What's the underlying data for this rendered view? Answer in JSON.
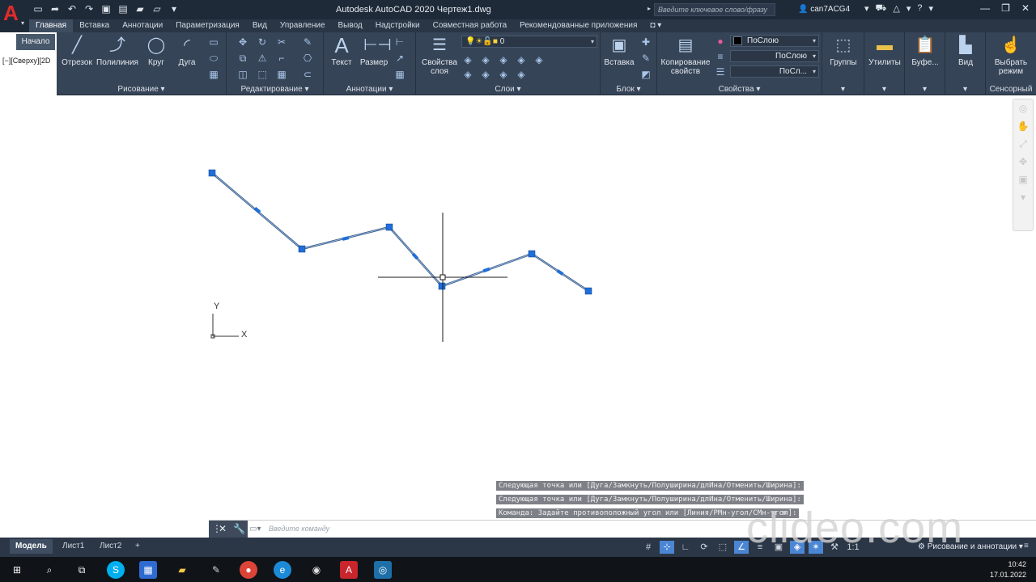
{
  "window": {
    "title": "Autodesk AutoCAD 2020   Чертеж1.dwg",
    "search_placeholder": "Введите ключевое слово/фразу",
    "user": "can7ACG4"
  },
  "ribbon_tabs": [
    "Главная",
    "Вставка",
    "Аннотации",
    "Параметризация",
    "Вид",
    "Управление",
    "Вывод",
    "Надстройки",
    "Совместная работа",
    "Рекомендованные приложения"
  ],
  "start_tab": "Начало",
  "view_label": "[−][Сверху][2D",
  "ribbon": {
    "draw": {
      "title": "Рисование",
      "line": "Отрезок",
      "polyline": "Полилиния",
      "circle": "Круг",
      "arc": "Дуга"
    },
    "modify": {
      "title": "Редактирование"
    },
    "annotation": {
      "title": "Аннотации",
      "text": "Текст",
      "dimension": "Размер"
    },
    "layers": {
      "title": "Слои",
      "layer_props_1": "Свойства",
      "layer_props_2": "слоя",
      "current_layer": "0"
    },
    "block": {
      "title": "Блок",
      "insert": "Вставка"
    },
    "properties": {
      "title": "Свойства",
      "match_1": "Копирование",
      "match_2": "свойств",
      "color": "ПоСлою",
      "linetype": "ПоСлою",
      "lineweight": "ПоСл..."
    },
    "groups": "Группы",
    "utilities": "Утилиты",
    "clipboard": "Буфе...",
    "view": "Вид",
    "touch_1": "Выбрать",
    "touch_2": "режим",
    "touch_title": "Сенсорный"
  },
  "ucs": {
    "x": "X",
    "y": "Y"
  },
  "command_history": [
    "Следующая точка или [Дуга/Замкнуть/Полуширина/длИна/Отменить/Ширина]:",
    "Следующая точка или [Дуга/Замкнуть/Полуширина/длИна/Отменить/Ширина]:",
    "Команда: Задайте противоположный угол или [Линия/РМн-угол/СМн-угол]:"
  ],
  "command_placeholder": "Введите команду",
  "layout_tabs": [
    "Модель",
    "Лист1",
    "Лист2"
  ],
  "workspace": "Рисование и аннотации",
  "scale": "1:1",
  "clock": {
    "time": "10:42",
    "date": "17.01.2022"
  },
  "watermark": "clideo.com",
  "colors": {
    "accent": "#4b86d4",
    "grip": "#1e6fd9",
    "polyline": "#34547c"
  }
}
